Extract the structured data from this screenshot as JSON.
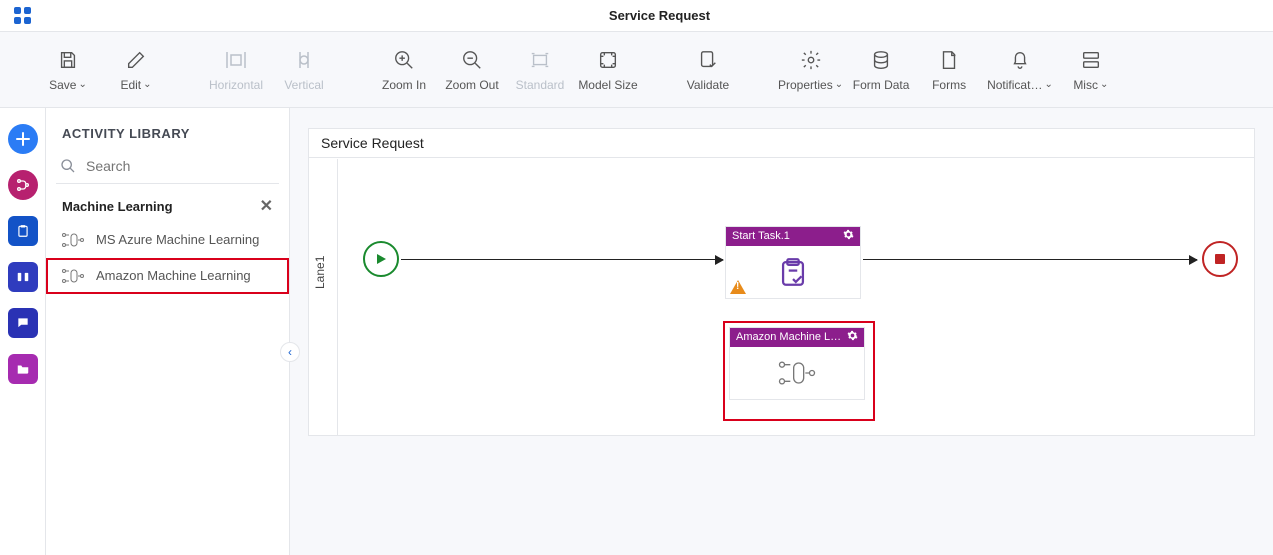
{
  "app_title": "Service Request",
  "toolbar": [
    {
      "id": "save",
      "label": "Save",
      "dropdown": true,
      "disabled": false
    },
    {
      "id": "edit",
      "label": "Edit",
      "dropdown": true,
      "disabled": false
    },
    {
      "gap": true
    },
    {
      "id": "horizontal",
      "label": "Horizontal",
      "dropdown": false,
      "disabled": true
    },
    {
      "id": "vertical",
      "label": "Vertical",
      "dropdown": false,
      "disabled": true
    },
    {
      "gap": true
    },
    {
      "id": "zoomin",
      "label": "Zoom In",
      "dropdown": false,
      "disabled": false
    },
    {
      "id": "zoomout",
      "label": "Zoom Out",
      "dropdown": false,
      "disabled": false
    },
    {
      "id": "standard",
      "label": "Standard",
      "dropdown": false,
      "disabled": true
    },
    {
      "id": "modelsize",
      "label": "Model Size",
      "dropdown": false,
      "disabled": false
    },
    {
      "gap": true
    },
    {
      "id": "validate",
      "label": "Validate",
      "dropdown": false,
      "disabled": false
    },
    {
      "gap": true
    },
    {
      "id": "properties",
      "label": "Properties",
      "dropdown": true,
      "disabled": false
    },
    {
      "id": "formdata",
      "label": "Form Data",
      "dropdown": false,
      "disabled": false
    },
    {
      "id": "forms",
      "label": "Forms",
      "dropdown": false,
      "disabled": false
    },
    {
      "id": "notifications",
      "label": "Notificat…",
      "dropdown": true,
      "disabled": false
    },
    {
      "id": "misc",
      "label": "Misc",
      "dropdown": true,
      "disabled": false
    }
  ],
  "panel": {
    "title": "ACTIVITY LIBRARY",
    "search_placeholder": "Search",
    "group": {
      "name": "Machine Learning",
      "items": [
        {
          "id": "azureml",
          "label": "MS Azure Machine Learning",
          "highlight": false
        },
        {
          "id": "awsml",
          "label": "Amazon Machine Learning",
          "highlight": true
        }
      ]
    }
  },
  "canvas": {
    "title": "Service Request",
    "lane": "Lane1",
    "nodes": {
      "task1_title": "Start Task.1",
      "aml_title": "Amazon Machine Learn…"
    }
  }
}
